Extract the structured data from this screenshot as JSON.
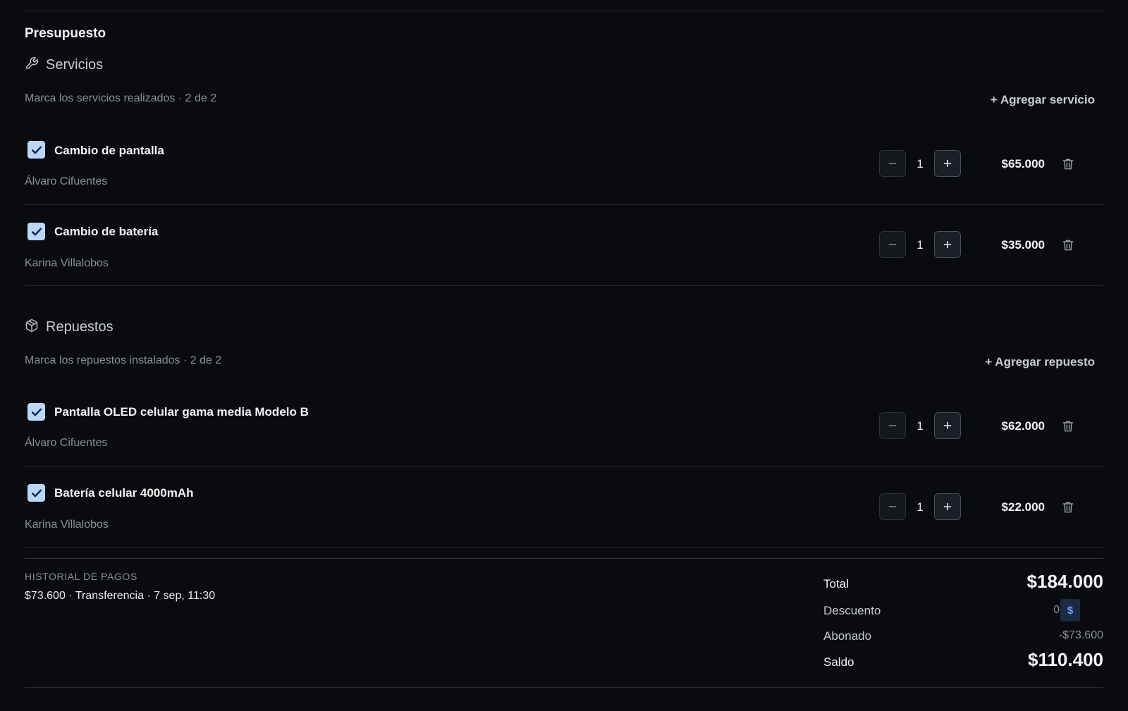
{
  "budget": {
    "title": "Presupuesto"
  },
  "services": {
    "icon": "wrench-icon",
    "title": "Servicios",
    "subtitle": "Marca los servicios realizados · 2 de 2",
    "add_label": "+ Agregar servicio",
    "items": [
      {
        "name": "Cambio de pantalla",
        "person": "Álvaro Cifuentes",
        "qty": "1",
        "price": "$65.000",
        "checked": true
      },
      {
        "name": "Cambio de batería",
        "person": "Karina Villalobos",
        "qty": "1",
        "price": "$35.000",
        "checked": true
      }
    ]
  },
  "parts": {
    "icon": "package-icon",
    "title": "Repuestos",
    "subtitle": "Marca los repuestos instalados · 2 de 2",
    "add_label": "+ Agregar repuesto",
    "items": [
      {
        "name": "Pantalla OLED celular gama media Modelo B",
        "person": "Álvaro Cifuentes",
        "qty": "1",
        "price": "$62.000",
        "checked": true
      },
      {
        "name": "Batería celular 4000mAh",
        "person": "Karina Villalobos",
        "qty": "1",
        "price": "$22.000",
        "checked": true
      }
    ]
  },
  "payments": {
    "label": "HISTORIAL DE PAGOS",
    "entries": [
      "$73.600 · Transferencia · 7 sep, 11:30"
    ]
  },
  "summary": {
    "total_label": "Total",
    "total_value": "$184.000",
    "discount_label": "Descuento",
    "discount_value": "0",
    "discount_unit": "$",
    "paid_label": "Abonado",
    "paid_value": "-$73.600",
    "balance_label": "Saldo",
    "balance_value": "$110.400"
  },
  "colors": {
    "background": "#090b0f",
    "checkbox": "#bcd7f6",
    "discount_toggle": "#1c2a44",
    "discount_toggle_text": "#6fa4ef"
  }
}
